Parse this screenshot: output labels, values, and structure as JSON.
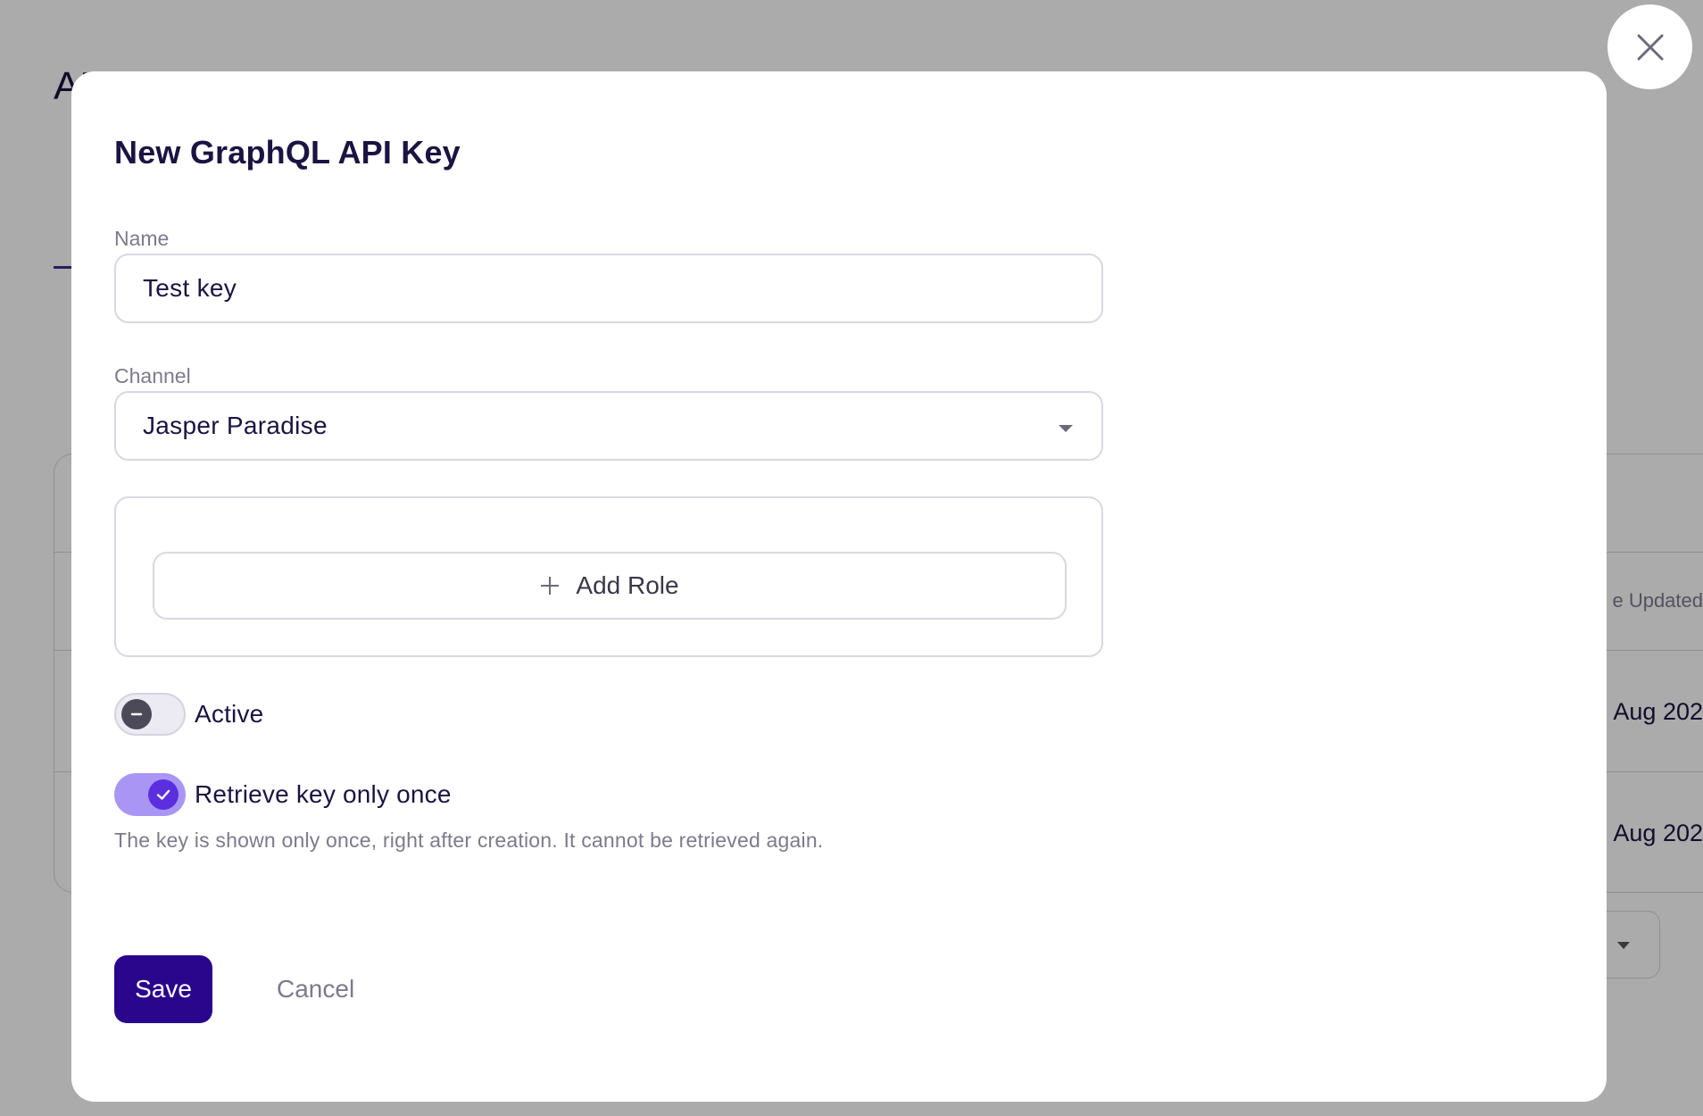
{
  "background": {
    "page_title_partial": "AP",
    "table_header_partial": "e Updated",
    "rows": [
      {
        "date_partial": "Aug 202"
      },
      {
        "date_partial": "Aug 202"
      }
    ]
  },
  "modal": {
    "title": "New GraphQL API Key",
    "name_field": {
      "label": "Name",
      "value": "Test key"
    },
    "channel_field": {
      "label": "Channel",
      "value": "Jasper Paradise"
    },
    "roles": {
      "add_role_label": "Add Role"
    },
    "active_toggle": {
      "label": "Active",
      "state": "off"
    },
    "retrieve_once_toggle": {
      "label": "Retrieve key only once",
      "state": "on",
      "helper": "The key is shown only once, right after creation. It cannot be retrieved again."
    },
    "actions": {
      "save_label": "Save",
      "cancel_label": "Cancel"
    }
  },
  "icons": {
    "close": "close-icon",
    "caret": "chevron-down-icon",
    "plus": "plus-icon",
    "check": "check-icon",
    "minus": "minus-icon"
  },
  "colors": {
    "primary": "#2a068d",
    "toggle_on_track": "#a996f4",
    "toggle_on_knob": "#5b2fe0",
    "heading": "#1b1442",
    "muted": "#7d7a8c"
  }
}
